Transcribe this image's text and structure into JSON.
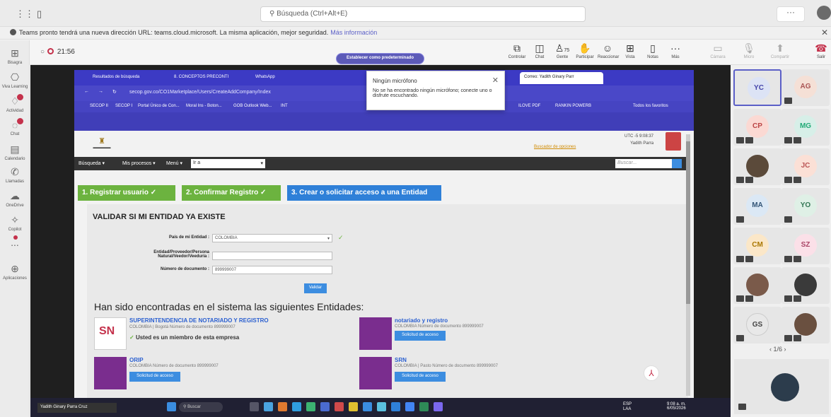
{
  "teams": {
    "search_placeholder": "Búsqueda (Ctrl+Alt+E)",
    "window_more": "···",
    "notice": "Teams pronto tendrá una nueva dirección URL: teams.cloud.microsoft. La misma aplicación, mejor seguridad.",
    "notice_link": "Más información",
    "rail": [
      {
        "label": "Bisagra",
        "icon": "grid-icon"
      },
      {
        "label": "Viva Learning",
        "icon": "learning-icon"
      },
      {
        "label": "Actividad",
        "icon": "bell-icon"
      },
      {
        "label": "Chat",
        "icon": "chat-icon"
      },
      {
        "label": "Calendario",
        "icon": "calendar-icon"
      },
      {
        "label": "Llamadas",
        "icon": "phone-icon"
      },
      {
        "label": "OneDrive",
        "icon": "cloud-icon"
      },
      {
        "label": "Copilot",
        "icon": "copilot-icon"
      },
      {
        "label": "...",
        "icon": "more-icon"
      },
      {
        "label": "Aplicaciones",
        "icon": "apps-icon"
      }
    ],
    "timer": "21:56",
    "meeting_buttons": [
      {
        "label": "Controlar",
        "icon": "control-icon"
      },
      {
        "label": "Chat",
        "icon": "chat-icon"
      },
      {
        "label": "Gente",
        "icon": "people-icon",
        "count": "75"
      },
      {
        "label": "Participar",
        "icon": "hand-icon"
      },
      {
        "label": "Reaccionar",
        "icon": "emoji-icon"
      },
      {
        "label": "Vista",
        "icon": "view-icon"
      },
      {
        "label": "Notas",
        "icon": "notes-icon"
      },
      {
        "label": "Más",
        "icon": "more-icon"
      },
      {
        "label": "Cámara",
        "icon": "camera-icon"
      },
      {
        "label": "Micro",
        "icon": "mic-icon"
      },
      {
        "label": "Compartir",
        "icon": "share-icon"
      }
    ],
    "leave_label": "Salir",
    "participants": [
      "YC",
      "AG",
      "CP",
      "MG",
      "",
      "JC",
      "MA",
      "YO",
      "CM",
      "SZ",
      "",
      "",
      "GS",
      ""
    ],
    "pager": "1/6"
  },
  "browser": {
    "tabs": [
      "Resultados de búsqueda",
      "8. CONCEPTOS PRECONTI",
      "WhatsApp",
      "Correo: Yadith Ginary Parr"
    ],
    "url": "secop.gov.co/CO1Marketplace/Users/CreateAddCompany/Index",
    "bookmarks": [
      "SECOP II",
      "SECOP I",
      "Portal Único de Con...",
      "Moral Ins - Boton...",
      "GOB Outlook Web...",
      "INT",
      "ILOVE PDF",
      "RANKIN POWERB",
      "Todos los favoritos"
    ],
    "default_button": "Establecer como predeterminado",
    "popup": {
      "title": "Ningún micrófono",
      "text": "No se ha encontrado ningún micrófono; conecte uno o disfrute escuchando."
    }
  },
  "secop": {
    "utc": "UTC -5 9:08:37",
    "user": "Yadith Parra",
    "help_link": "Buscador de opciones",
    "nav": [
      "Búsqueda",
      "Mis procesos",
      "Menú"
    ],
    "ira": "Ir a",
    "search_placeholder": "Buscar...",
    "steps": [
      "1. Registrar usuario",
      "2. Confirmar Registro",
      "3. Crear o solicitar acceso a una Entidad"
    ],
    "validate_title": "VALIDAR SI MI ENTIDAD YA EXISTE",
    "fields": [
      {
        "label": "País de mi Entidad :",
        "value": "COLOMBIA"
      },
      {
        "label": "Entidad/Proveedor/Persona Natural/Veedor/Veeduría :",
        "value": ""
      },
      {
        "label": "Número de documento :",
        "value": "899999007"
      }
    ],
    "validate_button": "Validar",
    "found_title": "Han sido encontradas en el sistema las siguientes Entidades:",
    "entities": [
      {
        "name": "SUPERINTENDENCIA DE NOTARIADO Y REGISTRO",
        "detail": "COLOMBIA | Bogotá Número de documento 899999007",
        "member": "Usted es un miembro de esta empresa"
      },
      {
        "name": "notariado y registro",
        "detail": "COLOMBIA Número de documento 899999007",
        "button": "Solicitud de acceso"
      },
      {
        "name": "ORIP",
        "detail": "COLOMBIA Número de documento 899999007",
        "button": "Solicitud de acceso"
      },
      {
        "name": "SRN",
        "detail": "COLOMBIA | Pasto Número de documento 899999007",
        "button": "Solicitud de acceso"
      }
    ]
  },
  "taskbar": {
    "presenter": "Yadith Ginary Parra Cruz",
    "search": "Buscar",
    "lang": "ESP LAA",
    "time": "9:08 a. m.",
    "date": "6/05/2026"
  },
  "colors": {
    "accent": "#5b5fc7",
    "step_done": "#6cb33f",
    "step_active": "#2f80d8",
    "leave": "#c4314b"
  }
}
